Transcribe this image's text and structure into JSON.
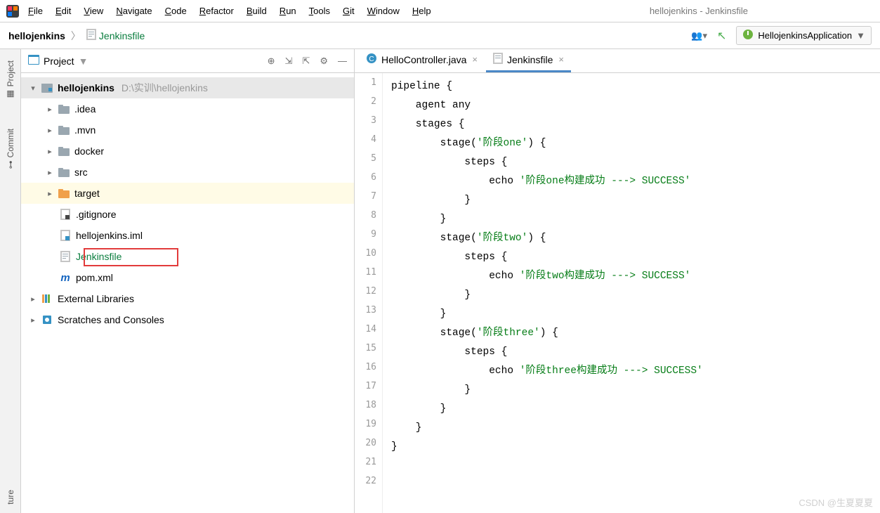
{
  "window_title": "hellojenkins - Jenkinsfile",
  "menu": [
    "File",
    "Edit",
    "View",
    "Navigate",
    "Code",
    "Refactor",
    "Build",
    "Run",
    "Tools",
    "Git",
    "Window",
    "Help"
  ],
  "breadcrumb": {
    "project": "hellojenkins",
    "file": "Jenkinsfile"
  },
  "run_config": {
    "label": "HellojenkinsApplication"
  },
  "side_tabs": {
    "project": "Project",
    "commit": "Commit",
    "structure": "ture"
  },
  "panel": {
    "title": "Project"
  },
  "tree": {
    "root": {
      "name": "hellojenkins",
      "path": "D:\\实训\\hellojenkins"
    },
    "children": [
      {
        "name": ".idea",
        "type": "folder-grey"
      },
      {
        "name": ".mvn",
        "type": "folder-grey"
      },
      {
        "name": "docker",
        "type": "folder-grey"
      },
      {
        "name": "src",
        "type": "folder-grey"
      },
      {
        "name": "target",
        "type": "folder-orange"
      },
      {
        "name": ".gitignore",
        "type": "file-git"
      },
      {
        "name": "hellojenkins.iml",
        "type": "file-iml"
      },
      {
        "name": "Jenkinsfile",
        "type": "file-jenkins",
        "selected": true
      },
      {
        "name": "pom.xml",
        "type": "file-maven"
      }
    ],
    "ext_lib": "External Libraries",
    "scratches": "Scratches and Consoles"
  },
  "editor_tabs": [
    {
      "name": "HelloController.java",
      "icon": "java-class",
      "active": false
    },
    {
      "name": "Jenkinsfile",
      "icon": "file",
      "active": true
    }
  ],
  "code_lines": [
    {
      "n": 1,
      "t": "pipeline {"
    },
    {
      "n": 2,
      "t": "    agent any"
    },
    {
      "n": 3,
      "t": ""
    },
    {
      "n": 4,
      "t": "    stages {"
    },
    {
      "n": 5,
      "t": "        stage(",
      "s": "'阶段one'",
      "t2": ") {"
    },
    {
      "n": 6,
      "t": "            steps {"
    },
    {
      "n": 7,
      "t": "                echo ",
      "s": "'阶段one构建成功 ---> SUCCESS'"
    },
    {
      "n": 8,
      "t": "            }"
    },
    {
      "n": 9,
      "t": "        }"
    },
    {
      "n": 10,
      "t": "        stage(",
      "s": "'阶段two'",
      "t2": ") {"
    },
    {
      "n": 11,
      "t": "            steps {"
    },
    {
      "n": 12,
      "t": "                echo ",
      "s": "'阶段two构建成功 ---> SUCCESS'"
    },
    {
      "n": 13,
      "t": "            }"
    },
    {
      "n": 14,
      "t": "        }"
    },
    {
      "n": 15,
      "t": "        stage(",
      "s": "'阶段three'",
      "t2": ") {"
    },
    {
      "n": 16,
      "t": "            steps {"
    },
    {
      "n": 17,
      "t": "                echo ",
      "s": "'阶段three构建成功 ---> SUCCESS'"
    },
    {
      "n": 18,
      "t": "            }"
    },
    {
      "n": 19,
      "t": "        }"
    },
    {
      "n": 20,
      "t": ""
    },
    {
      "n": 21,
      "t": "    }"
    },
    {
      "n": 22,
      "t": "}"
    }
  ],
  "watermark": "CSDN @生夏夏夏"
}
